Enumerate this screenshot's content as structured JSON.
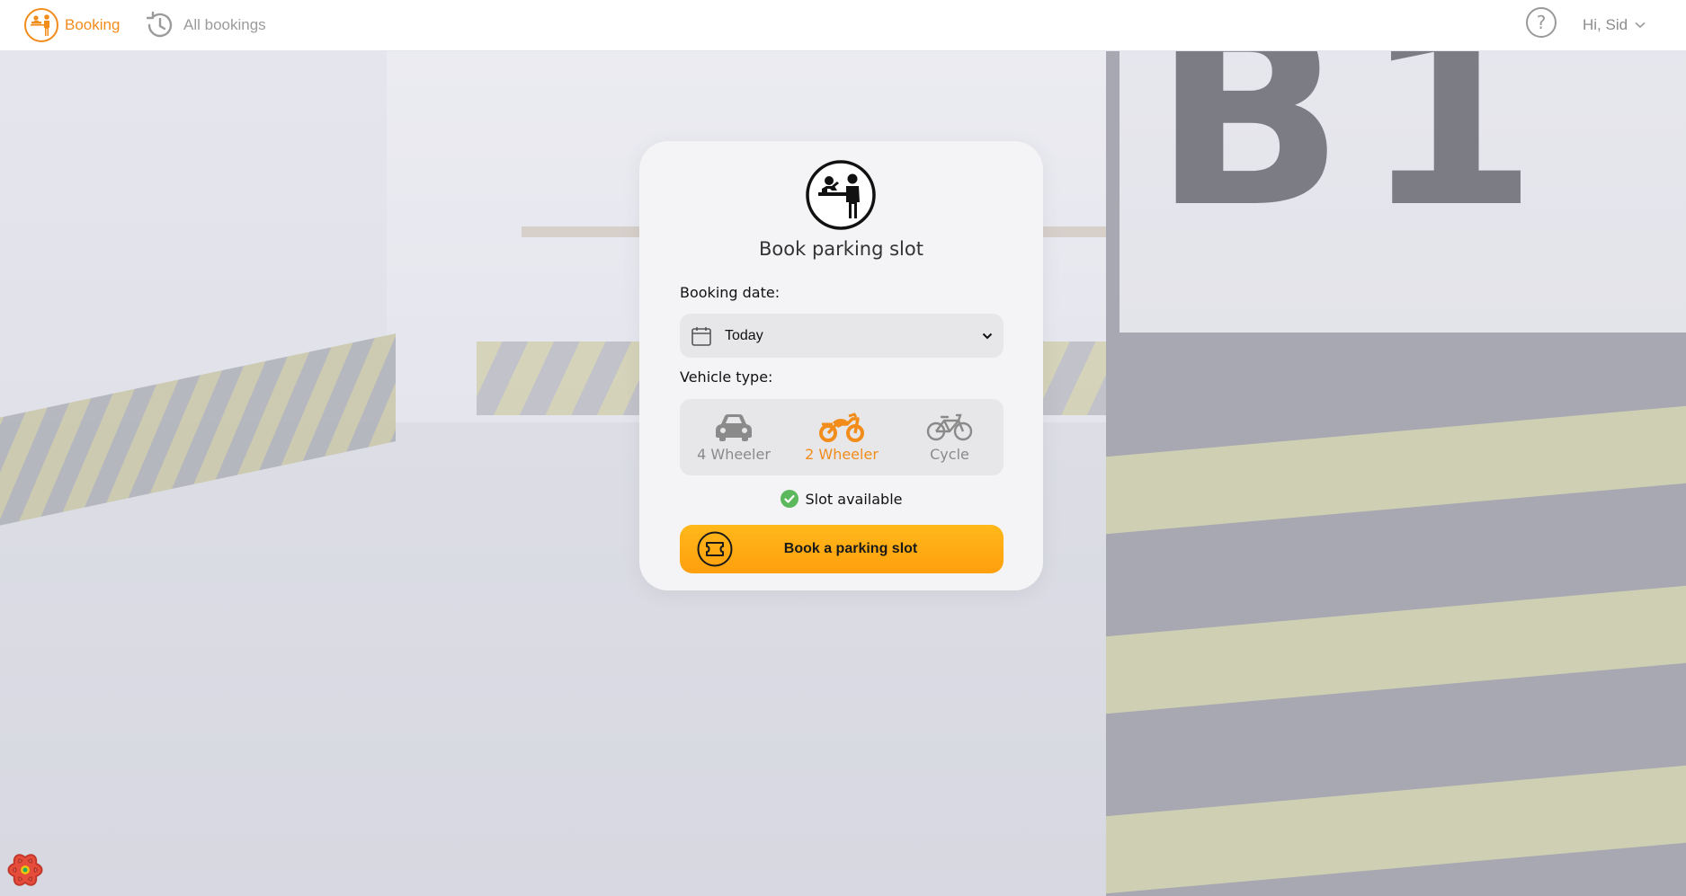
{
  "nav": {
    "booking_label": "Booking",
    "all_bookings_label": "All bookings",
    "help_symbol": "?",
    "user_greeting": "Hi, Sid"
  },
  "card": {
    "title": "Book parking slot",
    "booking_date_label": "Booking date:",
    "booking_date_value": "Today",
    "vehicle_type_label": "Vehicle type:",
    "vehicle_options": [
      {
        "label": "4 Wheeler",
        "icon": "car-icon",
        "selected": false
      },
      {
        "label": "2 Wheeler",
        "icon": "motorcycle-icon",
        "selected": true
      },
      {
        "label": "Cycle",
        "icon": "bicycle-icon",
        "selected": false
      }
    ],
    "slot_status": "Slot available",
    "book_button_label": "Book a parking slot"
  },
  "colors": {
    "accent": "#f28c1b",
    "button_gradient_top": "#ffb81a",
    "button_gradient_bottom": "#ff9f0d",
    "success": "#5cb85c",
    "muted": "#8a8a8a"
  }
}
